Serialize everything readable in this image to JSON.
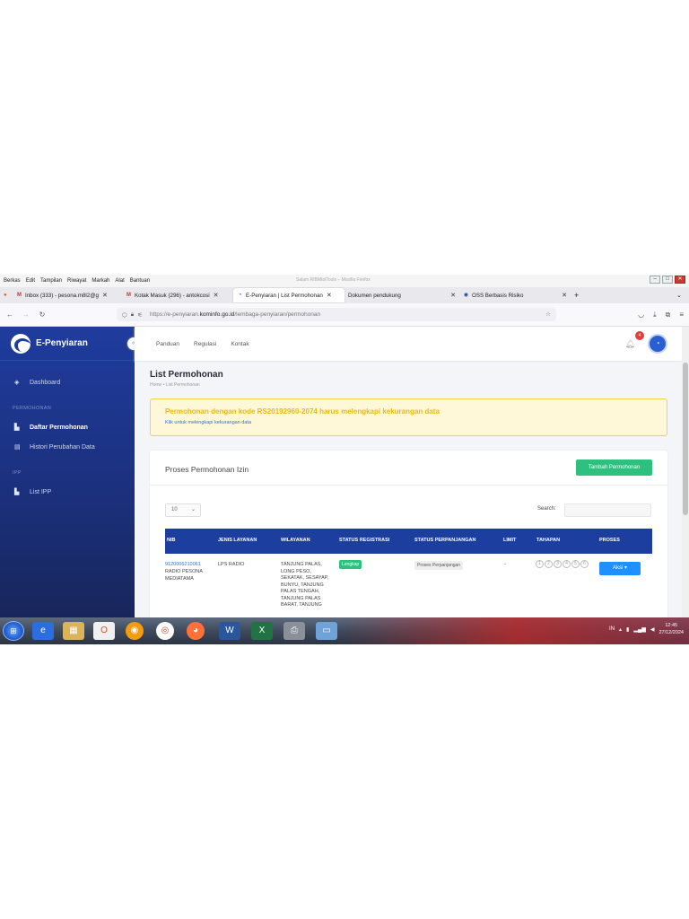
{
  "browser": {
    "menu": [
      "Berkas",
      "Edit",
      "Tampilan",
      "Riwayat",
      "Markah",
      "Alat",
      "Bantuan"
    ],
    "window_title": "Salam RIBMtolTools – Mozilla Firefox",
    "tabs": [
      {
        "label": "Inbox (333) - pesona.m8l2@g",
        "icon": "gmail-icon"
      },
      {
        "label": "Kotak Masuk (296) - antokcosi",
        "icon": "gmail-icon"
      },
      {
        "label": "E-Penyiaran | List Permohonan",
        "icon": "epenyiaran-icon"
      },
      {
        "label": "Dokumen pendukung",
        "icon": ""
      },
      {
        "label": "OSS Berbasis Risiko",
        "icon": "oss-icon"
      }
    ],
    "url_prefix": "https://e-penyiaran.",
    "url_domain": "kominfo.go.id",
    "url_path": "/lembaga-penyiaran/permohonan"
  },
  "app": {
    "brand": "E-Penyiaran",
    "collapse_symbol": "«",
    "sidebar": {
      "dashboard": "Dashboard",
      "section_permohonan": "PERMOHONAN",
      "daftar": "Daftar Permohonan",
      "histori": "Histori Perubahan Data",
      "section_ipp": "IPP",
      "list_ipp": "List IPP"
    },
    "topnav": [
      "Panduan",
      "Regulasi",
      "Kontak"
    ],
    "notif_count": "4",
    "page_title": "List Permohonan",
    "breadcrumb": "Home  •  List Permohonan",
    "alert": {
      "title": "Permohonan dengan kode RS20192960-2074 harus melengkapi kekurangan data",
      "link": "Klik untuk melengkapi kekurangan data"
    },
    "card": {
      "title": "Proses Permohonan Izin",
      "add_button": "Tambah Permohonan",
      "length_value": "10",
      "search_label": "Search:"
    },
    "table": {
      "headers": [
        "NIB",
        "JENIS LAYANAN",
        "WILAYANAN",
        "STATUS REGISTRASI",
        "STATUS PERPANJANGAN",
        "LIMIT",
        "TAHAPAN",
        "PROSES"
      ],
      "row": {
        "nib": "9120006210061",
        "nib_name": "RADIO PESONA MEDIATAMA",
        "jenis": "LPS RADIO",
        "wilayah": "TANJUNG PALAS, LONG PESO, SEKATAK, SESAYAP, BUNYU, TANJUNG PALAS TENGAH, TANJUNG PALAS BARAT, TANJUNG",
        "status_reg": "Lengkap",
        "status_perpanjangan": "Proses Perpanjangan",
        "limit": "-",
        "steps": [
          "1",
          "2",
          "3",
          "4",
          "5",
          "6"
        ],
        "aksi": "Aksi ▾"
      }
    }
  },
  "taskbar": {
    "lang": "IN",
    "time": "12:45",
    "date": "27/12/2024"
  }
}
